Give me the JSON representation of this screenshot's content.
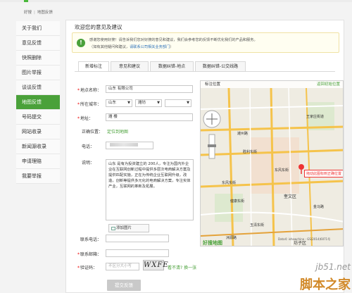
{
  "breadcrumb": {
    "home": "好搜",
    "current": "地图反馈"
  },
  "sidebar": {
    "items": [
      {
        "label": "关于我们"
      },
      {
        "label": "意见反馈"
      },
      {
        "label": "快照删除"
      },
      {
        "label": "图片举报"
      },
      {
        "label": "谈谈反馈"
      },
      {
        "label": "地图反馈",
        "active": true
      },
      {
        "label": "号码提交"
      },
      {
        "label": "网站收录"
      },
      {
        "label": "新闻源收录"
      },
      {
        "label": "申请理赔"
      },
      {
        "label": "我要举报"
      }
    ]
  },
  "main": {
    "title": "欢迎您的意见及建议",
    "notice_line1": "感谢您使用好搜！请告诉我们您对好搜的意见和建议，我们会参考您的反馈不断优化我们的产品和服务。",
    "notice_line2_prefix": "（如有其他疑问和建议，",
    "notice_link": "请联系公司相关业务部门",
    "notice_line2_suffix": "）"
  },
  "tabs": [
    {
      "label": "新增标注",
      "active": true
    },
    {
      "label": "意见和建议"
    },
    {
      "label": "数据纠错-地点"
    },
    {
      "label": "数据纠错-公交线路"
    }
  ],
  "form": {
    "place_name_label": "地点名称：",
    "place_name_value": "山东                  有限公司",
    "city_label": "所在城市：",
    "province": "山东",
    "city": "潍坊",
    "district": "",
    "address_label": "地址：",
    "address_value": "潍                         楼",
    "location_label": "正确位置：",
    "location_value": "定位到地图",
    "phone_label": "电话：",
    "phone_value": "",
    "desc_label": "说明：",
    "desc_value": "山东                  是有为投资建立的                  200人，专注为国内外企业在互联网创新过程中提供多层次电商解决方案及提供匹配实施，正在为传统企业互联网升级，改造，创新等提供多元化的电商解决方案，专注实体产业，互联网的革新及拓展。",
    "add_image": "添加图片",
    "contact_phone_label": "联系电话：",
    "contact_email_label": "联系邮箱：",
    "captcha_label": "验证码：",
    "captcha_placeholder": "不区分大小写",
    "captcha_text": "WXFE",
    "captcha_refresh": "看不清? 换一张",
    "submit": "提交反馈"
  },
  "map": {
    "title": "标注位置",
    "return": "返回初始位置",
    "pin_label": "拖动此图标到正确位置",
    "labels": [
      "潍州路",
      "胜利东街",
      "东风东街",
      "健康东街",
      "东风东街",
      "玉清东街",
      "奎文区",
      "坊子区",
      "王家庄街道",
      "洲源路",
      "金马路"
    ],
    "brand": "好搜地图",
    "copyright": "Data© ishowchina - GS(2014)6071号"
  },
  "watermark": {
    "site": "jb51.net",
    "name": "脚本之家"
  },
  "colors": {
    "accent": "#4aa13a",
    "link": "#2a6fb8",
    "required": "#e00000"
  }
}
